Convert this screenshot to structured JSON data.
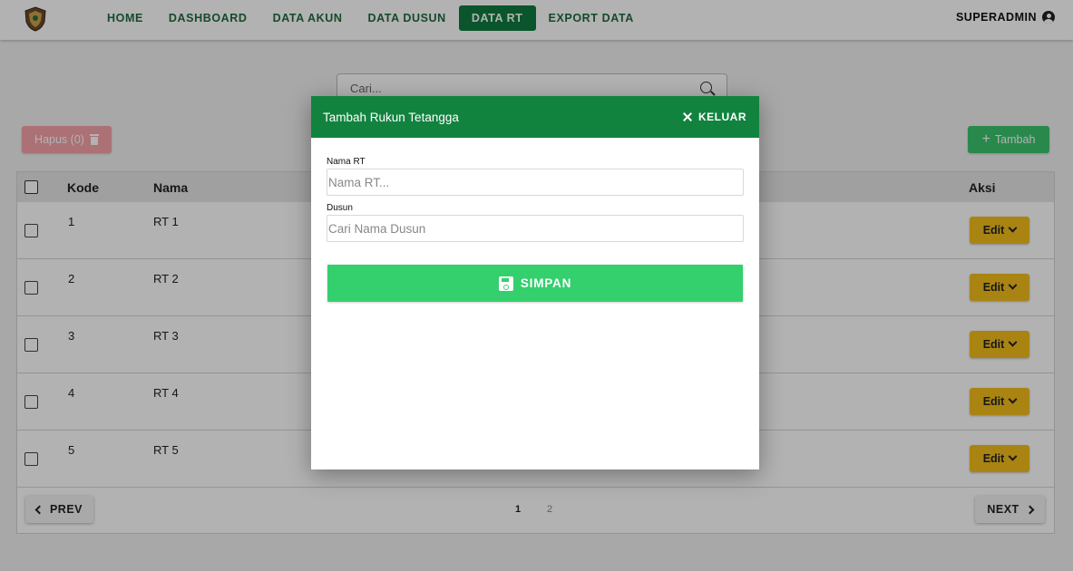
{
  "nav": {
    "items": [
      {
        "label": "HOME"
      },
      {
        "label": "DASHBOARD"
      },
      {
        "label": "DATA AKUN"
      },
      {
        "label": "DATA DUSUN"
      },
      {
        "label": "DATA RT",
        "active": true
      },
      {
        "label": "EXPORT DATA"
      }
    ],
    "user": "SUPERADMIN"
  },
  "search": {
    "placeholder": "Cari..."
  },
  "toolbar": {
    "hapus_label": "Hapus (0)",
    "tambah_label": "Tambah"
  },
  "table": {
    "columns": [
      "Kode",
      "Nama",
      "Aksi"
    ],
    "rows": [
      {
        "kode": "1",
        "nama": "RT 1",
        "action": "Edit"
      },
      {
        "kode": "2",
        "nama": "RT 2",
        "action": "Edit"
      },
      {
        "kode": "3",
        "nama": "RT 3",
        "action": "Edit"
      },
      {
        "kode": "4",
        "nama": "RT 4",
        "action": "Edit"
      },
      {
        "kode": "5",
        "nama": "RT 5",
        "action": "Edit"
      }
    ]
  },
  "pagination": {
    "prev": "PREV",
    "next": "NEXT",
    "pages": [
      "1",
      "2"
    ],
    "current": "1"
  },
  "modal": {
    "title": "Tambah Rukun Tetangga",
    "close_label": "KELUAR",
    "fields": [
      {
        "label": "Nama RT",
        "placeholder": "Nama RT..."
      },
      {
        "label": "Dusun",
        "placeholder": "Cari Nama Dusun"
      }
    ],
    "submit_label": "SIMPAN"
  },
  "colors": {
    "brand_green": "#12833f",
    "nav_active": "#0f7a3e",
    "submit_green": "#33d06d",
    "edit_yellow": "#f3bd1c",
    "delete_red": "#f5a3a8"
  }
}
